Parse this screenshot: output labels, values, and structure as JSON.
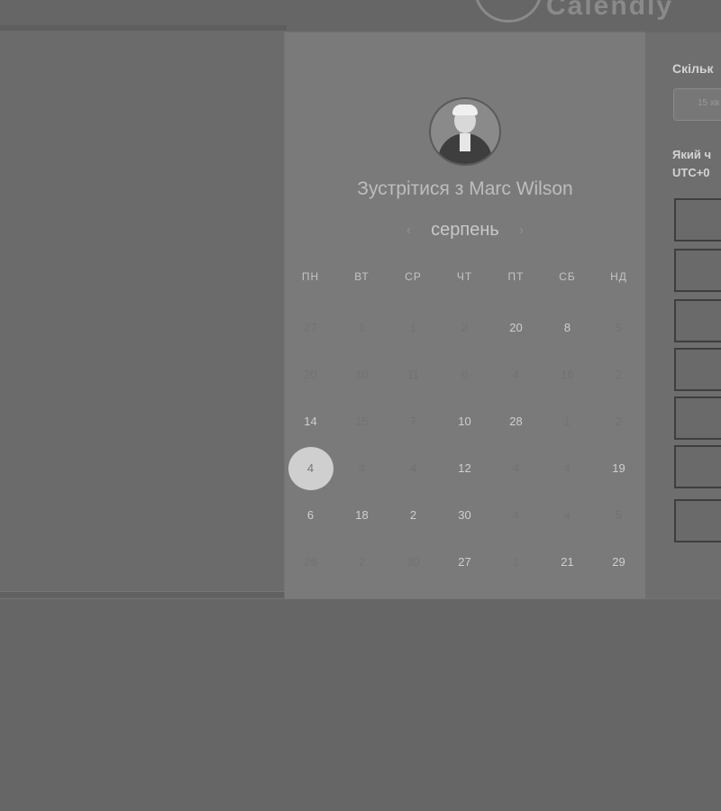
{
  "logo": {
    "text": "Calendly"
  },
  "modal": {
    "title": "Зустрітися з Marc Wilson",
    "month": "серпень",
    "weekdays": [
      "ПН",
      "ВТ",
      "СР",
      "ЧТ",
      "ПТ",
      "СБ",
      "НД"
    ],
    "weeks": [
      [
        {
          "d": "27",
          "a": false
        },
        {
          "d": "1",
          "a": false
        },
        {
          "d": "1",
          "a": false
        },
        {
          "d": "2",
          "a": false
        },
        {
          "d": "20",
          "a": true
        },
        {
          "d": "8",
          "a": true
        },
        {
          "d": "5",
          "a": false
        }
      ],
      [
        {
          "d": "20",
          "a": false
        },
        {
          "d": "10",
          "a": false
        },
        {
          "d": "11",
          "a": false
        },
        {
          "d": "6",
          "a": false
        },
        {
          "d": "4",
          "a": false
        },
        {
          "d": "16",
          "a": false
        },
        {
          "d": "2",
          "a": false
        }
      ],
      [
        {
          "d": "14",
          "a": true
        },
        {
          "d": "15",
          "a": false
        },
        {
          "d": "7",
          "a": false
        },
        {
          "d": "10",
          "a": true
        },
        {
          "d": "28",
          "a": true
        },
        {
          "d": "1",
          "a": false
        },
        {
          "d": "2",
          "a": false
        }
      ],
      [
        {
          "d": "4",
          "a": true,
          "selected": true
        },
        {
          "d": "4",
          "a": false
        },
        {
          "d": "4",
          "a": false
        },
        {
          "d": "12",
          "a": true
        },
        {
          "d": "4",
          "a": false
        },
        {
          "d": "4",
          "a": false
        },
        {
          "d": "19",
          "a": true
        }
      ],
      [
        {
          "d": "6",
          "a": true
        },
        {
          "d": "18",
          "a": true
        },
        {
          "d": "2",
          "a": true
        },
        {
          "d": "30",
          "a": true
        },
        {
          "d": "4",
          "a": false
        },
        {
          "d": "4",
          "a": false
        },
        {
          "d": "5",
          "a": false
        }
      ],
      [
        {
          "d": "26",
          "a": false
        },
        {
          "d": "2",
          "a": false
        },
        {
          "d": "30",
          "a": false
        },
        {
          "d": "27",
          "a": true
        },
        {
          "d": "1",
          "a": false
        },
        {
          "d": "21",
          "a": true
        },
        {
          "d": "29",
          "a": true
        }
      ]
    ]
  },
  "right_panel": {
    "duration_label": "Скільк",
    "duration_value": "15 хв",
    "time_label": "Який ч",
    "timezone": "UTC+0",
    "slots": [
      "",
      "",
      "",
      "",
      "",
      "",
      ""
    ]
  }
}
